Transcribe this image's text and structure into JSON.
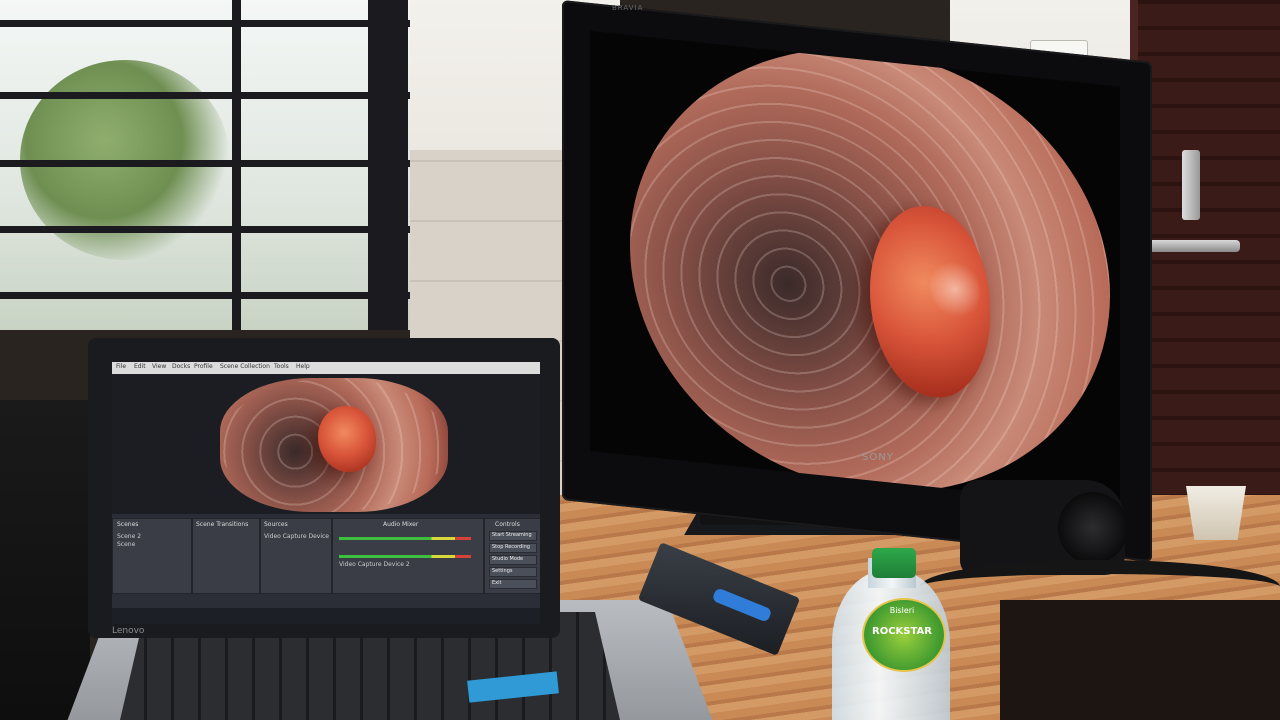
{
  "scene": {
    "description_kind": "photo",
    "monitor": {
      "brand": "SONY",
      "series": "BRAVIA"
    },
    "laptop": {
      "brand": "Lenovo",
      "obs": {
        "menu": [
          "File",
          "Edit",
          "View",
          "Docks",
          "Profile",
          "Scene Collection",
          "Tools",
          "Help"
        ],
        "panels": [
          "Scenes",
          "Sources",
          "Audio Mixer",
          "Scene Transitions",
          "Controls"
        ],
        "controls": [
          "Start Streaming",
          "Stop Recording",
          "Studio Mode",
          "Settings",
          "Exit"
        ],
        "scene_items": [
          "Scene 2",
          "Scene"
        ],
        "sources": [
          "Video Capture Device",
          "Video Capture Device 2"
        ]
      }
    },
    "bottle_label": "ROCKSTAR",
    "bottle_brand": "Bisleri"
  },
  "colors": {
    "mucosa": "#c98a78",
    "polyp": "#d9553a",
    "desk": "#c98a55",
    "door": "#3a1b17"
  }
}
